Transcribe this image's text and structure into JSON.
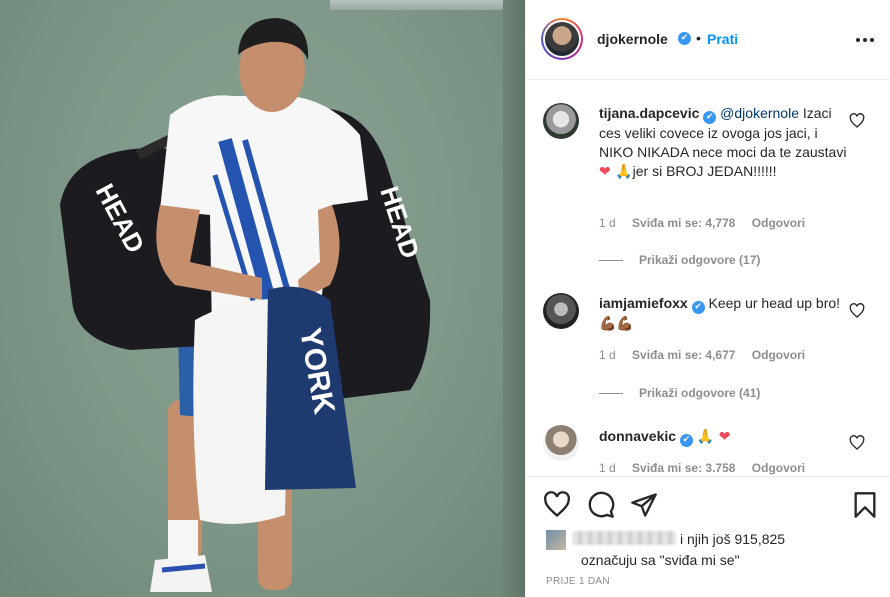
{
  "post": {
    "author": "djokernole",
    "separator": "•",
    "follow_label": "Prati",
    "verified_mark": "✔",
    "more_icon": "more-horizontal-icon",
    "photo_bag_brand_left": "HEAD",
    "photo_bag_brand_right": "HEAD",
    "photo_towel_text": "YORK"
  },
  "comments": [
    {
      "user": "tijana.dapcevic",
      "mention": "@djokernole",
      "text": "Izaci ces veliki covece iz ovoga jos jaci, i NIKO NIKADA nece moci da te zaustavi",
      "emoji": "❤ 🙏",
      "text_tail": "jer si BROJ JEDAN!!!!!!",
      "age": "1 d",
      "likes": "Sviđa mi se: 4,778",
      "reply_label": "Odgovori",
      "show_replies": "Prikaži odgovore (17)"
    },
    {
      "user": "iamjamiefoxx",
      "text": "Keep ur head up bro!",
      "emoji": "💪🏾💪🏾",
      "age": "1 d",
      "likes": "Sviđa mi se: 4,677",
      "reply_label": "Odgovori",
      "show_replies": "Prikaži odgovore (41)"
    },
    {
      "user": "donnavekic",
      "emoji": "🙏 ❤",
      "age": "1 d",
      "likes": "Sviđa mi se: 3.758",
      "reply_label": "Odgovori"
    }
  ],
  "actions": {
    "like_icon": "heart-icon",
    "comment_icon": "comment-icon",
    "share_icon": "share-icon",
    "save_icon": "bookmark-icon"
  },
  "likes_summary": {
    "line1": "i njih još 915,825",
    "line2": "označuju sa \"sviđa mi se\""
  },
  "timestamp": "PRIJE 1 DAN",
  "colors": {
    "accent": "#0095f6",
    "verified": "#3897f0",
    "heart_red": "#ed4956",
    "muted": "#8e8e8e"
  }
}
